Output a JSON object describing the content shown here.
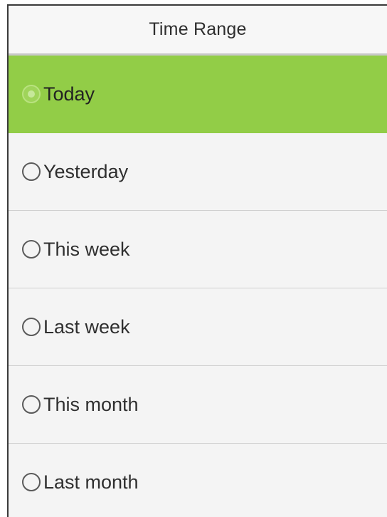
{
  "header": {
    "title": "Time Range"
  },
  "options": [
    {
      "label": "Today",
      "selected": true
    },
    {
      "label": "Yesterday",
      "selected": false
    },
    {
      "label": "This week",
      "selected": false
    },
    {
      "label": "Last week",
      "selected": false
    },
    {
      "label": "This month",
      "selected": false
    },
    {
      "label": "Last month",
      "selected": false
    }
  ],
  "colors": {
    "selected_background": "#92cd47",
    "list_background": "#f4f4f4",
    "divider": "#cfcfcf"
  }
}
